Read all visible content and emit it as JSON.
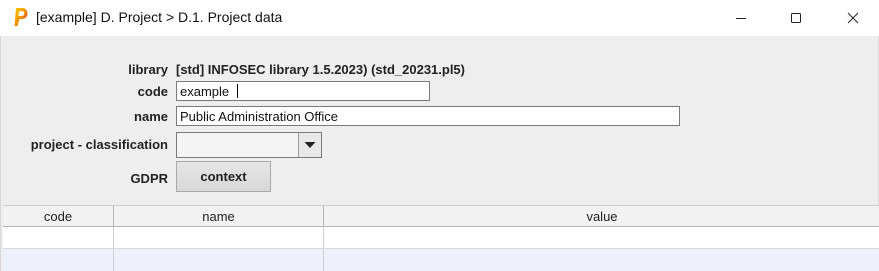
{
  "window": {
    "title": "[example] D. Project > D.1. Project data",
    "app_icon": "p-logo-icon",
    "controls": [
      "minimize-icon",
      "maximize-icon",
      "close-icon"
    ]
  },
  "form": {
    "library_label": "library",
    "library_value": "[std] INFOSEC library 1.5.2023) (std_20231.pl5)",
    "code_label": "code",
    "code_value": "example",
    "name_label": "name",
    "name_value": "Public Administration Office",
    "classification_label": "project - classification",
    "classification_value": "",
    "gdpr_label": "GDPR",
    "context_button": "context"
  },
  "table": {
    "columns": [
      "code",
      "name",
      "value"
    ],
    "rows": [
      [
        "",
        "",
        ""
      ],
      [
        "",
        "",
        ""
      ]
    ]
  },
  "colors": {
    "content_bg": "#eeeeee",
    "icon_gradient": [
      "#f5c400",
      "#e4007c"
    ],
    "alt_row": "#eef0fb"
  }
}
